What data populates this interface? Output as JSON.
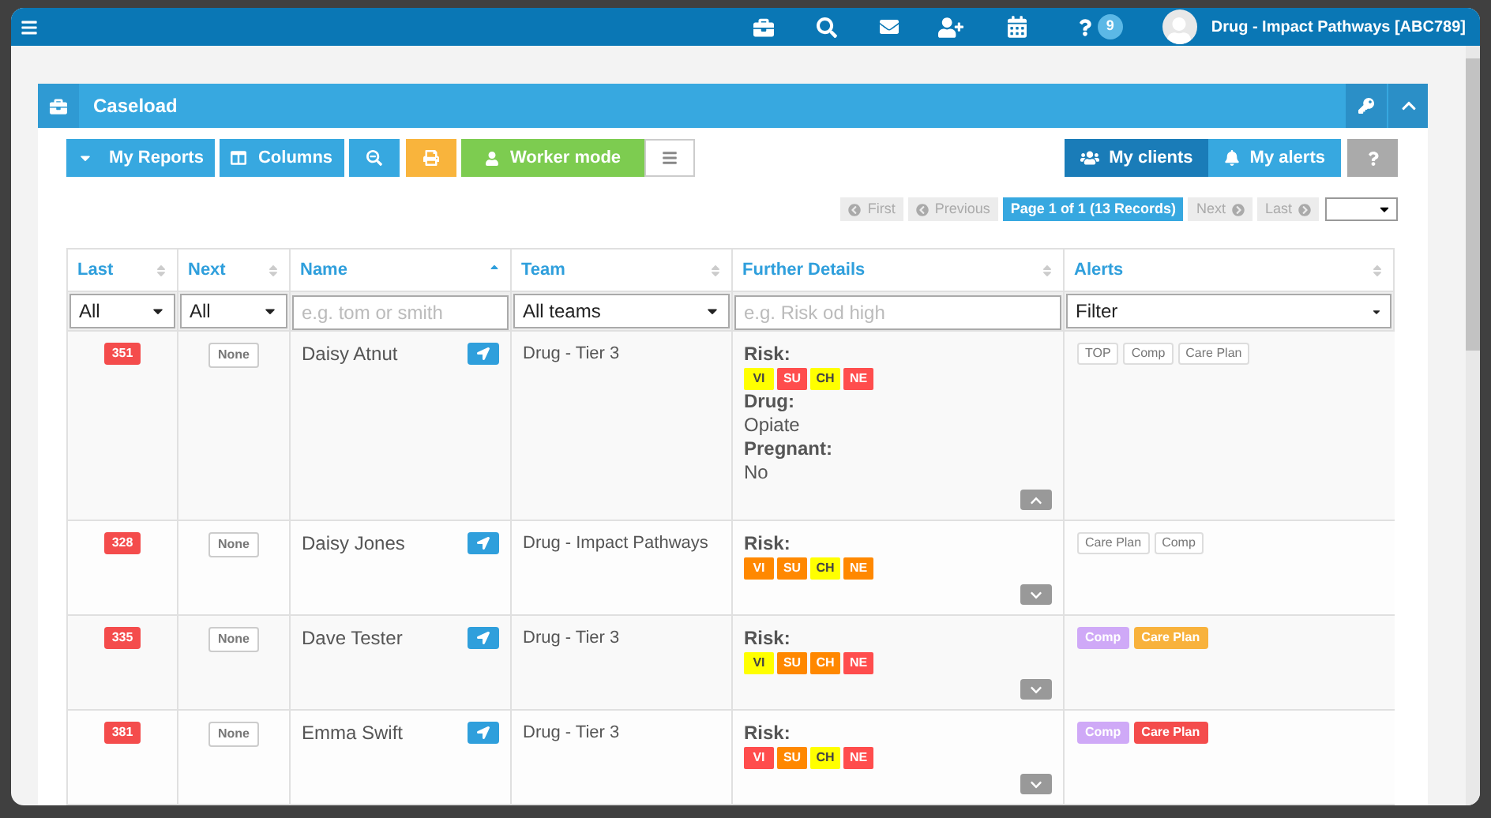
{
  "top_bar": {
    "help_count": "9",
    "user_label": "Drug - Impact Pathways [ABC789]"
  },
  "panel": {
    "title": "Caseload"
  },
  "toolbar": {
    "reports": "My Reports",
    "columns": "Columns",
    "worker_mode": "Worker mode",
    "views": [
      {
        "label": "My clients",
        "selected": true
      },
      {
        "label": "My alerts",
        "selected": false
      }
    ]
  },
  "pagination": {
    "items": [
      {
        "label": "First",
        "kind": "prev",
        "disabled": true
      },
      {
        "label": "Previous",
        "kind": "prev",
        "disabled": true
      },
      {
        "label": "Page 1 of 1 (13 Records)",
        "kind": "current",
        "disabled": false
      },
      {
        "label": "Next",
        "kind": "next",
        "disabled": true
      },
      {
        "label": "Last",
        "kind": "next",
        "disabled": true
      }
    ]
  },
  "table": {
    "columns": [
      {
        "label": "Last",
        "sorted": false,
        "filter": {
          "kind": "select",
          "value": "All"
        }
      },
      {
        "label": "Next",
        "sorted": false,
        "filter": {
          "kind": "select",
          "value": "All"
        }
      },
      {
        "label": "Name",
        "sorted": true,
        "filter": {
          "kind": "text",
          "placeholder": "e.g. tom or smith"
        }
      },
      {
        "label": "Team",
        "sorted": false,
        "filter": {
          "kind": "select",
          "value": "All teams"
        }
      },
      {
        "label": "Further Details",
        "sorted": false,
        "filter": {
          "kind": "text",
          "placeholder": "e.g. Risk od high"
        }
      },
      {
        "label": "Alerts",
        "sorted": false,
        "filter": {
          "kind": "dropdown",
          "value": "Filter"
        }
      }
    ],
    "rows": [
      {
        "kind": "full",
        "last": "351",
        "next": "None",
        "name": "Daisy Atnut",
        "team": "Drug - Tier 3",
        "risk_label": "Risk:",
        "expanded": true,
        "risks": [
          {
            "label": "VI",
            "color": "#ffff00"
          },
          {
            "label": "SU",
            "color": "#ff4d4d"
          },
          {
            "label": "CH",
            "color": "#ffff00"
          },
          {
            "label": "NE",
            "color": "#ff4d4d"
          }
        ],
        "details": [
          {
            "label": "Drug:",
            "value": "Opiate"
          },
          {
            "label": "Pregnant:",
            "value": "No"
          }
        ],
        "alerts": [
          {
            "label": "TOP"
          },
          {
            "label": "Comp"
          },
          {
            "label": "Care Plan"
          }
        ]
      },
      {
        "kind": "full",
        "last": "328",
        "next": "None",
        "name": "Daisy Jones",
        "team": "Drug - Impact Pathways",
        "risk_label": "Risk:",
        "expanded": false,
        "risks": [
          {
            "label": "VI",
            "color": "#ff8800"
          },
          {
            "label": "SU",
            "color": "#ff8800"
          },
          {
            "label": "CH",
            "color": "#ffff00"
          },
          {
            "label": "NE",
            "color": "#ff8800"
          }
        ],
        "alerts": [
          {
            "label": "Care Plan"
          },
          {
            "label": "Comp"
          }
        ]
      },
      {
        "kind": "full",
        "last": "335",
        "next": "None",
        "name": "Dave Tester",
        "team": "Drug - Tier 3",
        "risk_label": "Risk:",
        "expanded": false,
        "risks": [
          {
            "label": "VI",
            "color": "#ffff00"
          },
          {
            "label": "SU",
            "color": "#ff8800"
          },
          {
            "label": "CH",
            "color": "#ff8800"
          },
          {
            "label": "NE",
            "color": "#ff4d4d"
          }
        ],
        "alerts": [
          {
            "label": "Comp",
            "color": "#cfa9f7"
          },
          {
            "label": "Care Plan",
            "color": "#f8b23c"
          }
        ]
      },
      {
        "kind": "full",
        "last": "381",
        "next": "None",
        "name": "Emma Swift",
        "team": "Drug - Tier 3",
        "risk_label": "Risk:",
        "expanded": false,
        "risks": [
          {
            "label": "VI",
            "color": "#ff4d4d"
          },
          {
            "label": "SU",
            "color": "#ff8800"
          },
          {
            "label": "CH",
            "color": "#ffff00"
          },
          {
            "label": "NE",
            "color": "#ff4d4d"
          }
        ],
        "alerts": [
          {
            "label": "Comp",
            "color": "#cfa9f7"
          },
          {
            "label": "Care Plan",
            "color": "#f44c4c"
          }
        ]
      },
      {
        "kind": "cut"
      }
    ]
  }
}
